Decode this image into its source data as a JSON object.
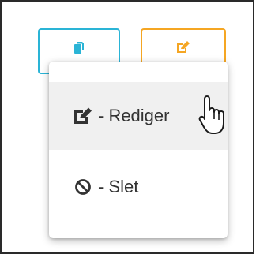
{
  "toolbar": {
    "copy_icon": "copy-icon",
    "edit_icon": "edit-icon",
    "copy_color": "#2ab4d6",
    "edit_color": "#f5a623"
  },
  "menu": {
    "items": [
      {
        "icon": "edit-icon",
        "label": "- Rediger",
        "state": "hover"
      },
      {
        "icon": "ban-icon",
        "label": "- Slet"
      }
    ]
  },
  "cursor": {
    "icon": "hand-pointer-icon"
  }
}
